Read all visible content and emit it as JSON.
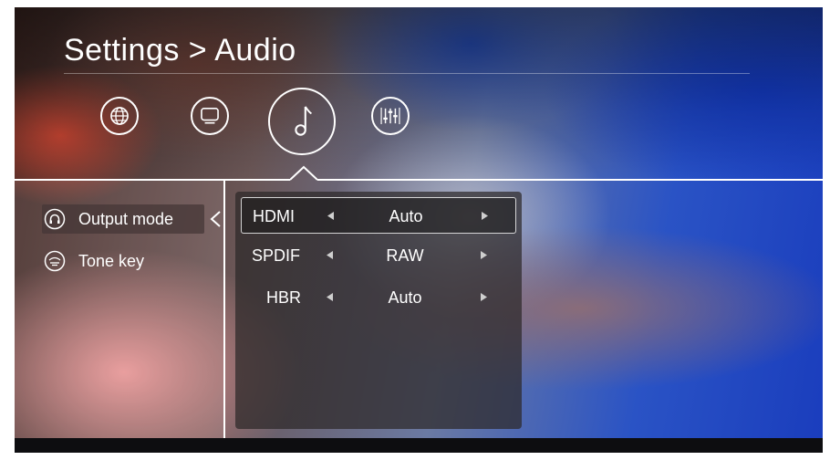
{
  "header": {
    "title": "Settings > Audio"
  },
  "categories": [
    {
      "id": "network",
      "icon": "globe-icon"
    },
    {
      "id": "display",
      "icon": "monitor-icon"
    },
    {
      "id": "audio",
      "icon": "music-note-icon",
      "selected": true
    },
    {
      "id": "equalizer",
      "icon": "equalizer-icon"
    }
  ],
  "sidebar": {
    "items": [
      {
        "label": "Output mode",
        "icon": "headphones-icon",
        "selected": true
      },
      {
        "label": "Tone key",
        "icon": "tone-key-icon",
        "selected": false
      }
    ]
  },
  "options": [
    {
      "label": "HDMI",
      "value": "Auto",
      "selected": true
    },
    {
      "label": "SPDIF",
      "value": "RAW",
      "selected": false
    },
    {
      "label": "HBR",
      "value": "Auto",
      "selected": false
    }
  ],
  "colors": {
    "accent": "#ffffff",
    "panel": "#2d2828",
    "arrow": "#cfcfcf"
  }
}
